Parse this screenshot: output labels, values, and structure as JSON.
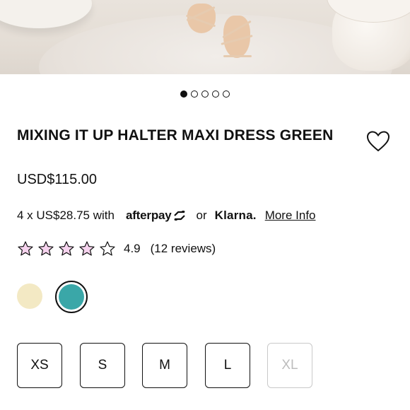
{
  "carousel": {
    "total": 5,
    "active_index": 0
  },
  "product": {
    "title": "MIXING IT UP HALTER MAXI DRESS GREEN",
    "price": "USD$115.00"
  },
  "payment": {
    "installments_text": "4 x US$28.75 with",
    "afterpay_label": "afterpay",
    "or_text": "or",
    "klarna_label": "Klarna.",
    "more_info_label": "More Info"
  },
  "rating": {
    "stars_filled": 4,
    "stars_total": 5,
    "value": "4.9",
    "count_text": "(12 reviews)"
  },
  "colors": {
    "swatches": [
      {
        "name": "cream-swatch",
        "hex": "#f3e9c4",
        "selected": false
      },
      {
        "name": "green-swatch",
        "hex": "#3aa7a8",
        "selected": true
      }
    ],
    "star_fill": "#f6d3ee"
  },
  "sizes": [
    {
      "label": "XS",
      "available": true
    },
    {
      "label": "S",
      "available": true
    },
    {
      "label": "M",
      "available": true
    },
    {
      "label": "L",
      "available": true
    },
    {
      "label": "XL",
      "available": false
    }
  ]
}
